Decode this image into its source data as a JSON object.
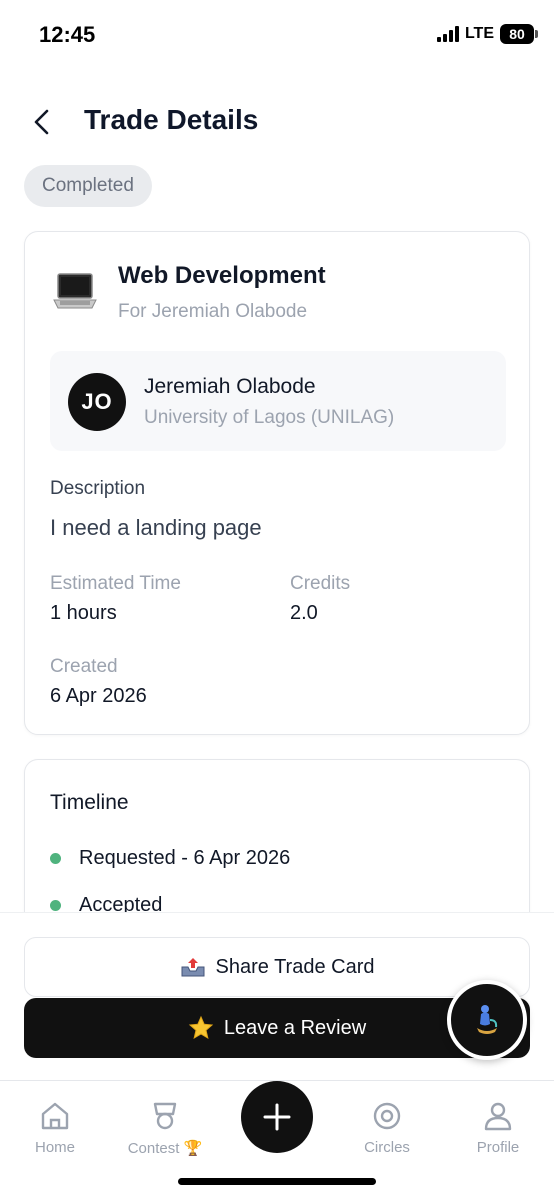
{
  "status_bar": {
    "time": "12:45",
    "network": "LTE",
    "battery": "80"
  },
  "header": {
    "title": "Trade Details"
  },
  "status_chip": "Completed",
  "trade": {
    "service_title": "Web Development",
    "service_subtitle": "For Jeremiah Olabode",
    "person": {
      "initials": "JO",
      "name": "Jeremiah Olabode",
      "university": "University of Lagos (UNILAG)"
    },
    "description_label": "Description",
    "description": "I need a landing page",
    "estimated_time_label": "Estimated Time",
    "estimated_time": "1 hours",
    "credits_label": "Credits",
    "credits": "2.0",
    "created_label": "Created",
    "created": "6 Apr 2026"
  },
  "timeline": {
    "title": "Timeline",
    "items": [
      {
        "label": "Requested - 6 Apr 2026"
      },
      {
        "label": "Accepted"
      }
    ]
  },
  "actions": {
    "share_label": "Share Trade Card",
    "review_label": "Leave a Review"
  },
  "tab_bar": {
    "home": "Home",
    "contest": "Contest 🏆",
    "circles": "Circles",
    "profile": "Profile"
  },
  "colors": {
    "accent_dark": "#111111",
    "timeline_dot": "#4fb37e",
    "muted_text": "#9ca3af"
  }
}
